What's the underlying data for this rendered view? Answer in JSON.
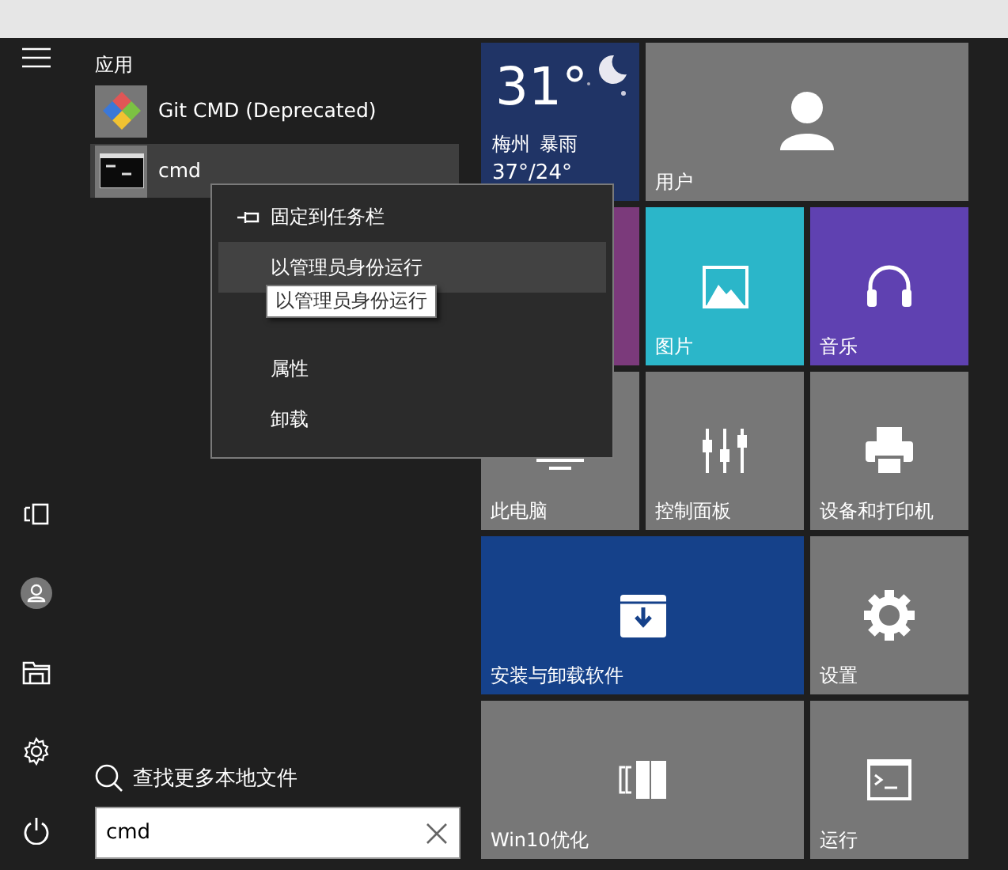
{
  "rail": [
    {
      "kind": "tablet"
    },
    {
      "kind": "user"
    },
    {
      "kind": "explorer"
    },
    {
      "kind": "settings"
    },
    {
      "kind": "power"
    }
  ],
  "apps_header": "应用",
  "apps": [
    {
      "name": "Git CMD (Deprecated)",
      "kind": "git",
      "selected": false
    },
    {
      "name": "cmd",
      "kind": "console",
      "selected": true
    }
  ],
  "search": {
    "hint": "查找更多本地文件",
    "value": "cmd"
  },
  "tiles": [
    {
      "kind": "weather",
      "temp": "31°",
      "city": "梅州",
      "condition": "暴雨",
      "range": "37°/24°",
      "wide": false,
      "color": "#203466"
    },
    {
      "kind": "user",
      "label": "用户",
      "wide": true,
      "color": "#777777"
    },
    {
      "kind": "blank",
      "wide": false,
      "color": "#7b3a7b"
    },
    {
      "kind": "pictures",
      "label": "图片",
      "wide": false,
      "color": "#2bb6c9"
    },
    {
      "kind": "music",
      "label": "音乐",
      "wide": false,
      "color": "#5f41b1"
    },
    {
      "kind": "pc",
      "label": "此电脑",
      "wide": false,
      "color": "#777777"
    },
    {
      "kind": "control",
      "label": "控制面板",
      "wide": false,
      "color": "#777777"
    },
    {
      "kind": "printer",
      "label": "设备和打印机",
      "wide": false,
      "color": "#777777"
    },
    {
      "kind": "install",
      "label": "安装与卸载软件",
      "wide": true,
      "color": "#15418a"
    },
    {
      "kind": "settings",
      "label": "设置",
      "wide": false,
      "color": "#777777"
    },
    {
      "kind": "optimize",
      "label": "Win10优化",
      "wide": true,
      "color": "#777777"
    },
    {
      "kind": "run",
      "label": "运行",
      "wide": false,
      "color": "#777777"
    }
  ],
  "context_menu": {
    "items": [
      {
        "kind": "pin",
        "label": "固定到任务栏",
        "selected": false
      },
      {
        "kind": "text",
        "label": "以管理员身份运行",
        "selected": true
      },
      {
        "kind": "covered",
        "selected": false
      },
      {
        "kind": "text",
        "label": "属性",
        "selected": false
      },
      {
        "kind": "text",
        "label": "卸载",
        "selected": false
      }
    ]
  },
  "tooltip": "以管理员身份运行"
}
